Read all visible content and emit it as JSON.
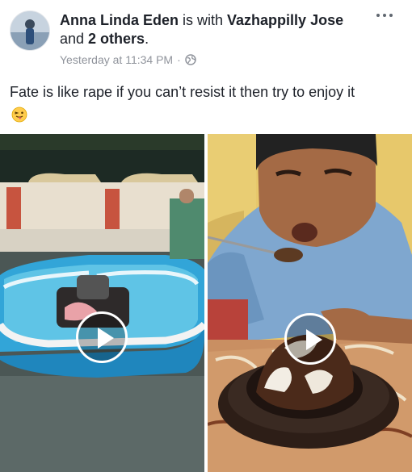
{
  "post": {
    "author": "Anna Linda Eden",
    "connector": " is with ",
    "tagged_person": "Vazhappilly Jose",
    "and_text": "and ",
    "others": "2 others",
    "period": ".",
    "timestamp": "Yesterday at 11:34 PM",
    "separator": "·",
    "privacy_icon": "globe-icon",
    "menu_icon": "more-options-icon",
    "text": "Fate is like rape if you can’t resist it then try to enjoy it",
    "emoji": "tongue-out-winking-face"
  },
  "media": {
    "videos": [
      {
        "subject": "inflatable-pool-in-flooded-yard",
        "play_icon": "play-icon"
      },
      {
        "subject": "man-eating-dessert",
        "play_icon": "play-icon"
      }
    ]
  }
}
